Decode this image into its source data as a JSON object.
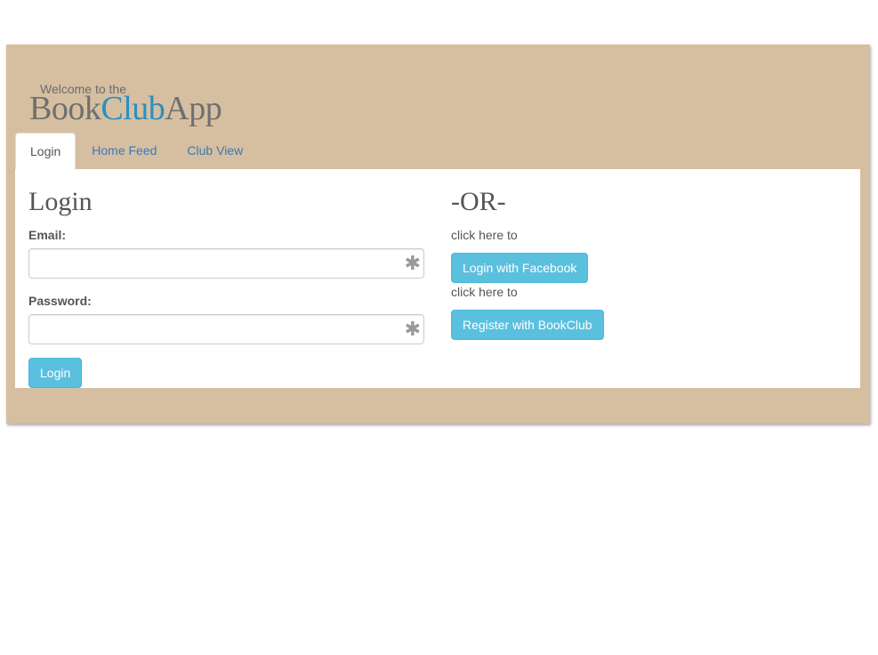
{
  "brand": {
    "welcome": "Welcome to the",
    "logo_part1": "Book",
    "logo_part2": "Club",
    "logo_part3": "App"
  },
  "tabs": [
    {
      "label": "Login",
      "active": true
    },
    {
      "label": "Home Feed",
      "active": false
    },
    {
      "label": "Club View",
      "active": false
    }
  ],
  "login": {
    "heading": "Login",
    "email_label": "Email:",
    "email_value": "",
    "password_label": "Password:",
    "password_value": "",
    "required_marker": "✱",
    "submit_label": "Login"
  },
  "alt": {
    "heading": "-OR-",
    "note1": "click here to",
    "facebook_label": "Login with Facebook",
    "note2": "click here to",
    "register_label": "Register with BookClub"
  },
  "colors": {
    "background_frame": "#d6bfa1",
    "brand_accent": "#2b8fc1",
    "button_info": "#5bc0de",
    "tab_link": "#3a78b5"
  }
}
